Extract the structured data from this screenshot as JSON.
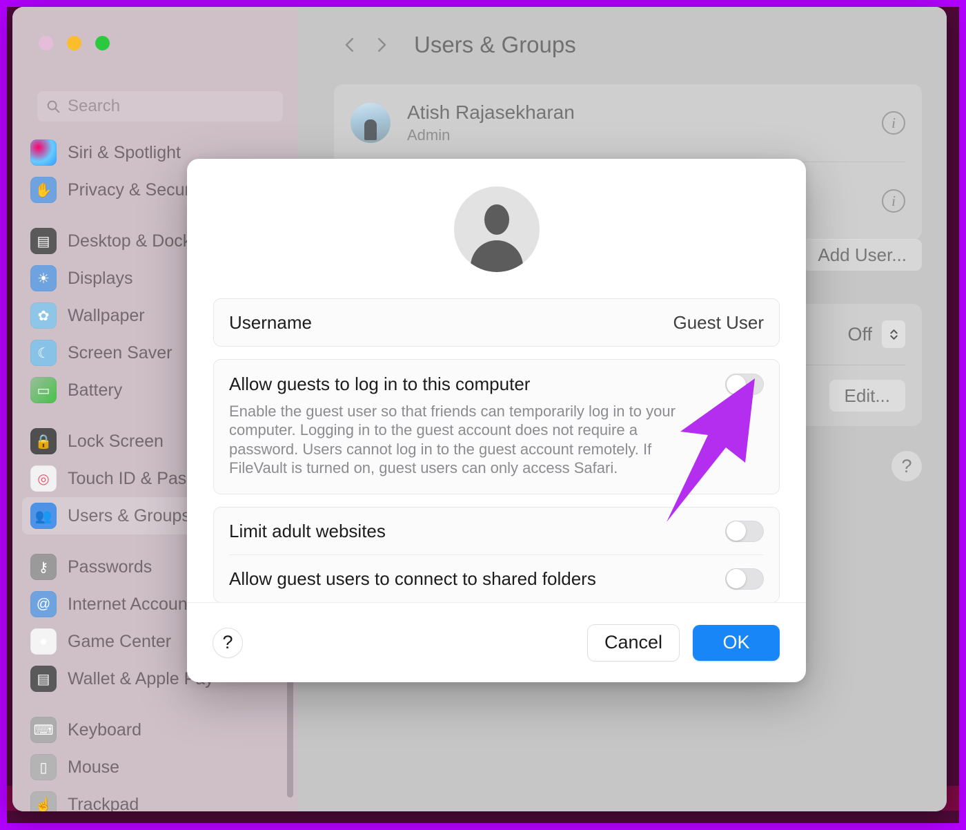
{
  "annotation": {
    "frame_color": "#b300ff",
    "frame_inner_color": "#4d0a38",
    "arrow_color": "#b42ef0",
    "arrow_points_to": "allow-guests-toggle"
  },
  "window": {
    "traffic_lights": [
      "close",
      "minimize",
      "zoom"
    ],
    "search": {
      "placeholder": "Search",
      "value": ""
    },
    "sidebar": {
      "groups": [
        {
          "items": [
            {
              "label": "Siri & Spotlight",
              "icon": "siri-icon",
              "icon_class": "ic-siri",
              "glyph": "",
              "selected": false
            },
            {
              "label": "Privacy & Security",
              "icon": "hand-icon",
              "icon_class": "ic-privacy",
              "glyph": "✋",
              "selected": false
            }
          ]
        },
        {
          "items": [
            {
              "label": "Desktop & Dock",
              "icon": "desktop-dock-icon",
              "icon_class": "ic-desktop",
              "glyph": "▤",
              "selected": false
            },
            {
              "label": "Displays",
              "icon": "brightness-icon",
              "icon_class": "ic-displays",
              "glyph": "☀",
              "selected": false
            },
            {
              "label": "Wallpaper",
              "icon": "flower-icon",
              "icon_class": "ic-wall",
              "glyph": "✿",
              "selected": false
            },
            {
              "label": "Screen Saver",
              "icon": "screen-saver-icon",
              "icon_class": "ic-saver",
              "glyph": "☾",
              "selected": false
            },
            {
              "label": "Battery",
              "icon": "battery-icon",
              "icon_class": "ic-battery",
              "glyph": "▭",
              "selected": false
            }
          ]
        },
        {
          "items": [
            {
              "label": "Lock Screen",
              "icon": "lock-icon",
              "icon_class": "ic-lock",
              "glyph": "🔒",
              "selected": false
            },
            {
              "label": "Touch ID & Password",
              "icon": "fingerprint-icon",
              "icon_class": "ic-touch",
              "glyph": "◎",
              "selected": false
            },
            {
              "label": "Users & Groups",
              "icon": "users-icon",
              "icon_class": "ic-users",
              "glyph": "👥",
              "selected": true
            }
          ]
        },
        {
          "items": [
            {
              "label": "Passwords",
              "icon": "key-icon",
              "icon_class": "ic-pass",
              "glyph": "⚷",
              "selected": false
            },
            {
              "label": "Internet Accounts",
              "icon": "at-sign-icon",
              "icon_class": "ic-internet",
              "glyph": "@",
              "selected": false
            },
            {
              "label": "Game Center",
              "icon": "game-center-icon",
              "icon_class": "ic-game",
              "glyph": "●",
              "selected": false
            },
            {
              "label": "Wallet & Apple Pay",
              "icon": "wallet-icon",
              "icon_class": "ic-wallet",
              "glyph": "▤",
              "selected": false
            }
          ]
        },
        {
          "items": [
            {
              "label": "Keyboard",
              "icon": "keyboard-icon",
              "icon_class": "ic-keyboard",
              "glyph": "⌨",
              "selected": false
            },
            {
              "label": "Mouse",
              "icon": "mouse-icon",
              "icon_class": "ic-mouse",
              "glyph": "▯",
              "selected": false
            },
            {
              "label": "Trackpad",
              "icon": "trackpad-icon",
              "icon_class": "ic-trackpad",
              "glyph": "☝",
              "selected": false
            }
          ]
        }
      ]
    },
    "detail": {
      "nav_back": "‹",
      "nav_forward": "›",
      "title": "Users & Groups",
      "user": {
        "name": "Atish Rajasekharan",
        "role": "Admin",
        "info_glyph": "i"
      },
      "add_user_button": "Add User...",
      "group_button_truncated": ".",
      "automatic_login_value": "Off",
      "edit_button": "Edit...",
      "help_glyph": "?"
    }
  },
  "sheet": {
    "avatar": "guest-user-avatar",
    "username_row": {
      "label": "Username",
      "value": "Guest User"
    },
    "allow_guests": {
      "title": "Allow guests to log in to this computer",
      "description": "Enable the guest user so that friends can temporarily log in to your computer. Logging in to the guest account does not require a password. Users cannot log in to the guest account remotely. If FileVault is turned on, guest users can only access Safari.",
      "toggle_state": "off"
    },
    "limit_adult_websites": {
      "label": "Limit adult websites",
      "toggle_state": "off"
    },
    "shared_folders": {
      "label": "Allow guest users to connect to shared folders",
      "toggle_state": "off"
    },
    "footer": {
      "help_glyph": "?",
      "cancel_label": "Cancel",
      "ok_label": "OK"
    }
  }
}
